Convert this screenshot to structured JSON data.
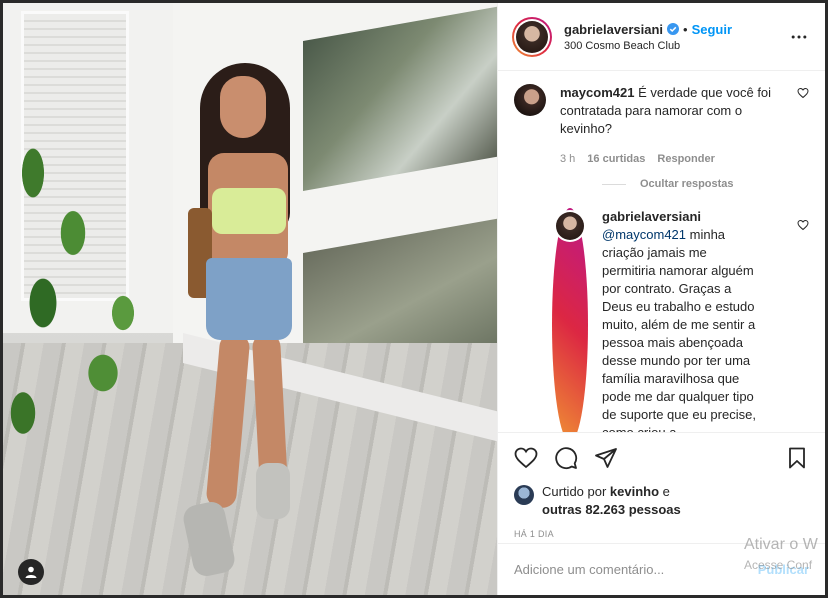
{
  "post": {
    "header": {
      "username": "gabrielaversiani",
      "separator": "•",
      "follow_label": "Seguir",
      "location": "300 Cosmo Beach Club"
    },
    "comments": [
      {
        "username": "maycom421",
        "text": "É verdade que você foi contratada para namorar com o kevinho?",
        "time": "3 h",
        "likes": "16 curtidas",
        "reply_label": "Responder"
      }
    ],
    "hide_replies_label": "Ocultar respostas",
    "reply": {
      "username": "gabrielaversiani",
      "mention": "@maycom421",
      "text": " minha criação jamais me permitiria namorar alguém por contrato. Graças a Deus eu trabalho e estudo muito, além de me sentir a pessoa mais abençoada desse mundo por ter uma família maravilhosa que pode me dar qualquer tipo de suporte que eu precise, como criou a"
    },
    "likes": {
      "prefix": "Curtido por ",
      "liker": "kevinho",
      "middle": " e ",
      "others": "outras 82.263 pessoas"
    },
    "time_ago": "HÁ 1 DIA",
    "add_comment": {
      "placeholder": "Adicione um comentário...",
      "publish_label": "Publicar"
    }
  },
  "watermark": {
    "line1": "Ativar o W",
    "line2": "Acesse Conf"
  },
  "colors": {
    "accent": "#0095f6",
    "text": "#262626",
    "muted": "#8e8e8e"
  }
}
